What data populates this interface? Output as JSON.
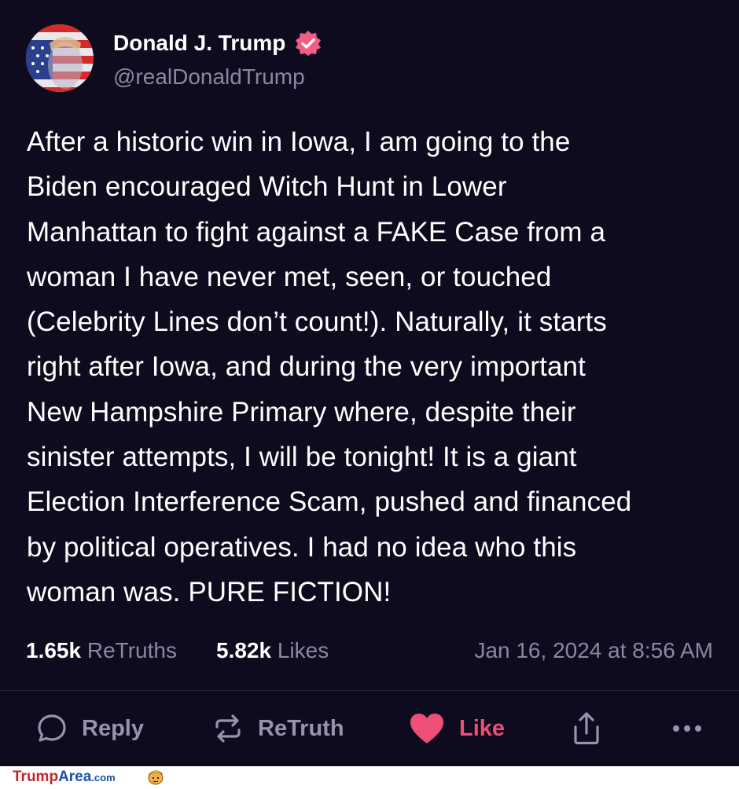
{
  "author": {
    "display_name": "Donald J. Trump",
    "handle": "@realDonaldTrump",
    "avatar_icon": "flag-portrait-avatar",
    "verified_icon": "verified-badge-icon"
  },
  "post": {
    "lines": [
      "After a historic win in Iowa, I am going to the",
      "Biden encouraged Witch Hunt in Lower",
      "Manhattan to fight against a FAKE Case from a",
      "woman I have never met, seen, or touched",
      "(Celebrity Lines don’t count!). Naturally, it starts",
      "right after Iowa, and during the very important",
      "New Hampshire Primary where, despite their",
      "sinister attempts, I will be tonight! It is a giant",
      "Election Interference Scam, pushed and financed",
      "by political operatives. I had no idea who this",
      "woman was. PURE FICTION!"
    ]
  },
  "stats": {
    "retruths_count": "1.65k",
    "retruths_label": "ReTruths",
    "likes_count": "5.82k",
    "likes_label": "Likes",
    "timestamp": "Jan 16, 2024 at 8:56 AM"
  },
  "actions": {
    "reply_label": "Reply",
    "retruth_label": "ReTruth",
    "like_label": "Like",
    "share_icon": "share-icon",
    "more_icon": "more-icon"
  },
  "footer": {
    "brand_part1": "Trump",
    "brand_part2": "Area",
    "brand_part3": ".com"
  },
  "colors": {
    "background": "#0f0b1f",
    "muted_text": "#8c87a0",
    "like_accent": "#ef4f77",
    "verified_badge": "#f25d85"
  }
}
